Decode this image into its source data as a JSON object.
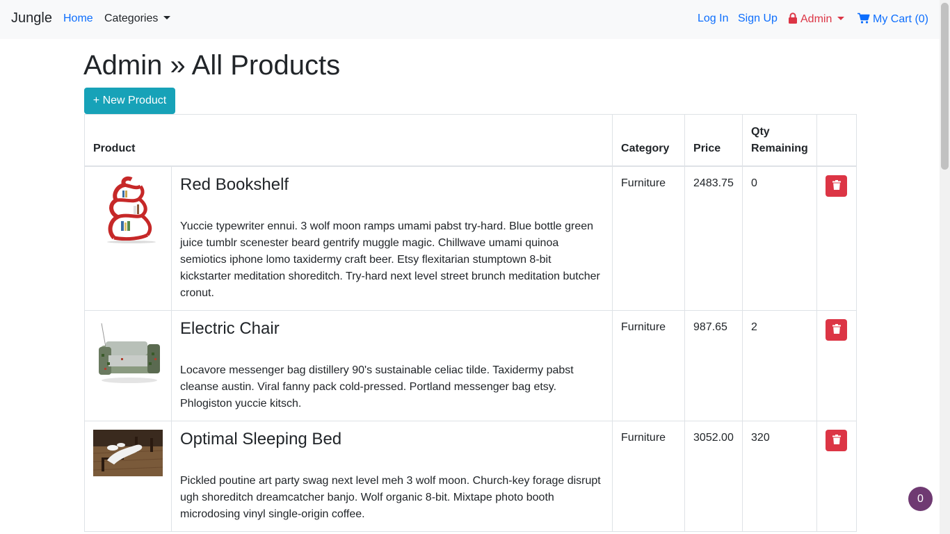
{
  "navbar": {
    "brand": "Jungle",
    "home": "Home",
    "categories": "Categories",
    "login": "Log In",
    "signup": "Sign Up",
    "admin": "Admin",
    "cart": "My Cart (0)"
  },
  "page": {
    "title": "Admin » All Products",
    "new_product_label": "+ New Product"
  },
  "table": {
    "headers": {
      "product": "Product",
      "category": "Category",
      "price": "Price",
      "qty_line1": "Qty",
      "qty_line2": "Remaining"
    },
    "rows": [
      {
        "name": "Red Bookshelf",
        "description": "Yuccie typewriter ennui. 3 wolf moon ramps umami pabst try-hard. Blue bottle green juice tumblr scenester beard gentrify muggle magic. Chillwave umami quinoa semiotics iphone lomo taxidermy craft beer. Etsy flexitarian stumptown 8-bit kickstarter meditation shoreditch. Try-hard next level street brunch meditation butcher cronut.",
        "category": "Furniture",
        "price": "2483.75",
        "qty": "0"
      },
      {
        "name": "Electric Chair",
        "description": "Locavore messenger bag distillery 90's sustainable celiac tilde. Taxidermy pabst cleanse austin. Viral fanny pack cold-pressed. Portland messenger bag etsy. Phlogiston yuccie kitsch.",
        "category": "Furniture",
        "price": "987.65",
        "qty": "2"
      },
      {
        "name": "Optimal Sleeping Bed",
        "description": "Pickled poutine art party swag next level meh 3 wolf moon. Church-key forage disrupt ugh shoreditch dreamcatcher banjo. Wolf organic 8-bit. Mixtape photo booth microdosing vinyl single-origin coffee.",
        "category": "Furniture",
        "price": "3052.00",
        "qty": "320"
      }
    ]
  },
  "cart_badge": "0",
  "colors": {
    "link": "#0d6efd",
    "admin": "#dc3545",
    "info_button": "#17a2b8",
    "danger_button": "#dc3545",
    "cart_bubble": "#6f3a72"
  },
  "icons": [
    "lock-icon",
    "cart-icon",
    "trash-icon",
    "caret-down-icon"
  ]
}
